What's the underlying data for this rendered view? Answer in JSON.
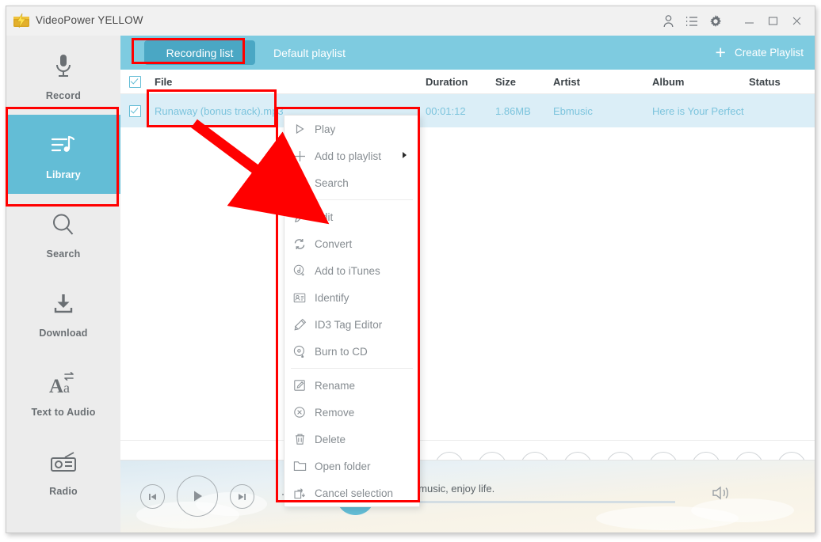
{
  "window": {
    "title": "VideoPower YELLOW",
    "logo_icon": "lightning-logo-icon",
    "titlebar_icons": [
      "user-icon",
      "list-icon",
      "gear-icon"
    ],
    "controls": {
      "minimize": "minimize-icon",
      "maximize": "maximize-icon",
      "close": "close-icon"
    }
  },
  "sidebar": {
    "items": [
      {
        "label": "Record",
        "icon": "microphone-icon",
        "active": false
      },
      {
        "label": "Library",
        "icon": "library-note-icon",
        "active": true
      },
      {
        "label": "Search",
        "icon": "search-icon",
        "active": false
      },
      {
        "label": "Download",
        "icon": "download-icon",
        "active": false
      },
      {
        "label": "Text to Audio",
        "icon": "text-to-audio-icon",
        "active": false
      },
      {
        "label": "Radio",
        "icon": "radio-icon",
        "active": false
      }
    ]
  },
  "tabs": [
    {
      "label": "Recording list",
      "active": true
    },
    {
      "label": "Default playlist",
      "active": false
    }
  ],
  "create_playlist": {
    "label": "Create Playlist",
    "icon": "plus-icon"
  },
  "table": {
    "columns": [
      "File",
      "Duration",
      "Size",
      "Artist",
      "Album",
      "Status"
    ],
    "header_checkbox_checked": true,
    "rows": [
      {
        "checked": true,
        "file": "Runaway (bonus track).mp3",
        "duration": "00:01:12",
        "size": "1.86MB",
        "artist": "Ebmusic",
        "album": "Here is Your Perfect",
        "status": ""
      }
    ]
  },
  "context_menu": {
    "items": [
      {
        "label": "Play",
        "icon": "play-icon",
        "submenu": false
      },
      {
        "label": "Add to playlist",
        "icon": "plus-icon",
        "submenu": true
      },
      {
        "label": "Search",
        "icon": "search-icon",
        "submenu": false
      },
      {
        "separator": true
      },
      {
        "label": "Edit",
        "icon": "pencil-icon",
        "submenu": false
      },
      {
        "label": "Convert",
        "icon": "convert-icon",
        "submenu": false
      },
      {
        "label": "Add to iTunes",
        "icon": "add-to-itunes-icon",
        "submenu": false
      },
      {
        "label": "Identify",
        "icon": "identify-card-icon",
        "submenu": false
      },
      {
        "label": "ID3 Tag Editor",
        "icon": "id3-tag-icon",
        "submenu": false
      },
      {
        "label": "Burn to CD",
        "icon": "burn-cd-icon",
        "submenu": false
      },
      {
        "separator": true
      },
      {
        "label": "Rename",
        "icon": "rename-icon",
        "submenu": false
      },
      {
        "label": "Remove",
        "icon": "remove-circle-icon",
        "submenu": false
      },
      {
        "label": "Delete",
        "icon": "trash-icon",
        "submenu": false
      },
      {
        "label": "Open folder",
        "icon": "folder-icon",
        "submenu": false
      },
      {
        "label": "Cancel selection",
        "icon": "cancel-selection-icon",
        "submenu": false
      }
    ]
  },
  "toolbar": {
    "buttons": [
      {
        "icon": "pencil-icon"
      },
      {
        "icon": "add-to-itunes-icon"
      },
      {
        "icon": "rename-icon"
      },
      {
        "icon": "remove-circle-icon"
      },
      {
        "icon": "trash-icon"
      },
      {
        "icon": "identify-card-icon"
      },
      {
        "icon": "id3-tag-icon"
      },
      {
        "icon": "folder-icon"
      },
      {
        "icon": "history-clock-icon"
      }
    ]
  },
  "player": {
    "previous_icon": "previous-track-icon",
    "play_icon": "play-icon",
    "next_icon": "next-track-icon",
    "repeat_icon": "repeat-arrow-icon",
    "album_art_icon": "music-note-icon",
    "now_playing": "Enjoy music, enjoy life.",
    "volume_icon": "speaker-icon"
  },
  "annotations": {
    "color": "#ff0000",
    "boxes": [
      "library-nav-item",
      "recording-list-tab",
      "file-name-cell",
      "context-menu"
    ],
    "arrow": "points from file name cell to context menu"
  }
}
